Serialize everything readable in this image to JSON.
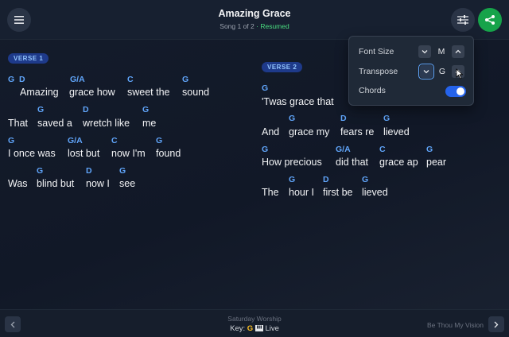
{
  "header": {
    "title": "Amazing Grace",
    "meta": "Song 1 of 2",
    "status": "· Resumed",
    "icons": {
      "menu": "hamburger-icon",
      "settings": "sliders-icon",
      "share": "share-icon"
    }
  },
  "verses": [
    {
      "label": "VERSE 1",
      "lines": [
        {
          "chords": [
            "G",
            "D",
            "G/A",
            "C",
            "G"
          ],
          "lyrics": [
            "Amazing",
            "grace how",
            "sweet the",
            "sound"
          ]
        },
        {
          "chords": [
            "G",
            "D",
            "G"
          ],
          "lyrics": [
            "That",
            "saved a",
            "wretch like",
            "me"
          ]
        },
        {
          "chords": [
            "G",
            "G/A",
            "C",
            "G"
          ],
          "lyrics": [
            "I once was",
            "lost but",
            "now I'm",
            "found"
          ]
        },
        {
          "chords": [
            "G",
            "D",
            "G"
          ],
          "lyrics": [
            "Was",
            "blind but",
            "now I",
            "see"
          ]
        }
      ]
    },
    {
      "label": "VERSE 2",
      "lines": [
        {
          "chords": [
            "G"
          ],
          "lyrics": [
            "'Twas grace that"
          ]
        },
        {
          "chords": [
            "G",
            "D",
            "G"
          ],
          "lyrics": [
            "And",
            "grace my",
            "fears re",
            "lieved"
          ]
        },
        {
          "chords": [
            "G",
            "G/A",
            "C",
            "G"
          ],
          "lyrics": [
            "How precious",
            "did that",
            "grace ap",
            "pear"
          ]
        },
        {
          "chords": [
            "G",
            "D",
            "G"
          ],
          "lyrics": [
            "The",
            "hour I",
            "first be",
            "lieved"
          ]
        }
      ]
    }
  ],
  "settings_popup": {
    "font_size_label": "Font Size",
    "font_size_value": "M",
    "transpose_label": "Transpose",
    "transpose_value": "G",
    "chords_label": "Chords",
    "chords_enabled": true
  },
  "footer": {
    "setlist": "Saturday Worship",
    "key_label": "Key:",
    "key_value": "G",
    "live_label": "Live",
    "next_song": "Be Thou My Vision",
    "icons": {
      "prev": "chevron-left-icon",
      "next": "chevron-right-icon",
      "live": "piano-icon"
    }
  },
  "colors": {
    "chord": "#60a5fa",
    "accent": "#2563eb",
    "share": "#16a34a",
    "resumed": "#4ade80",
    "key": "#fbbf24"
  }
}
